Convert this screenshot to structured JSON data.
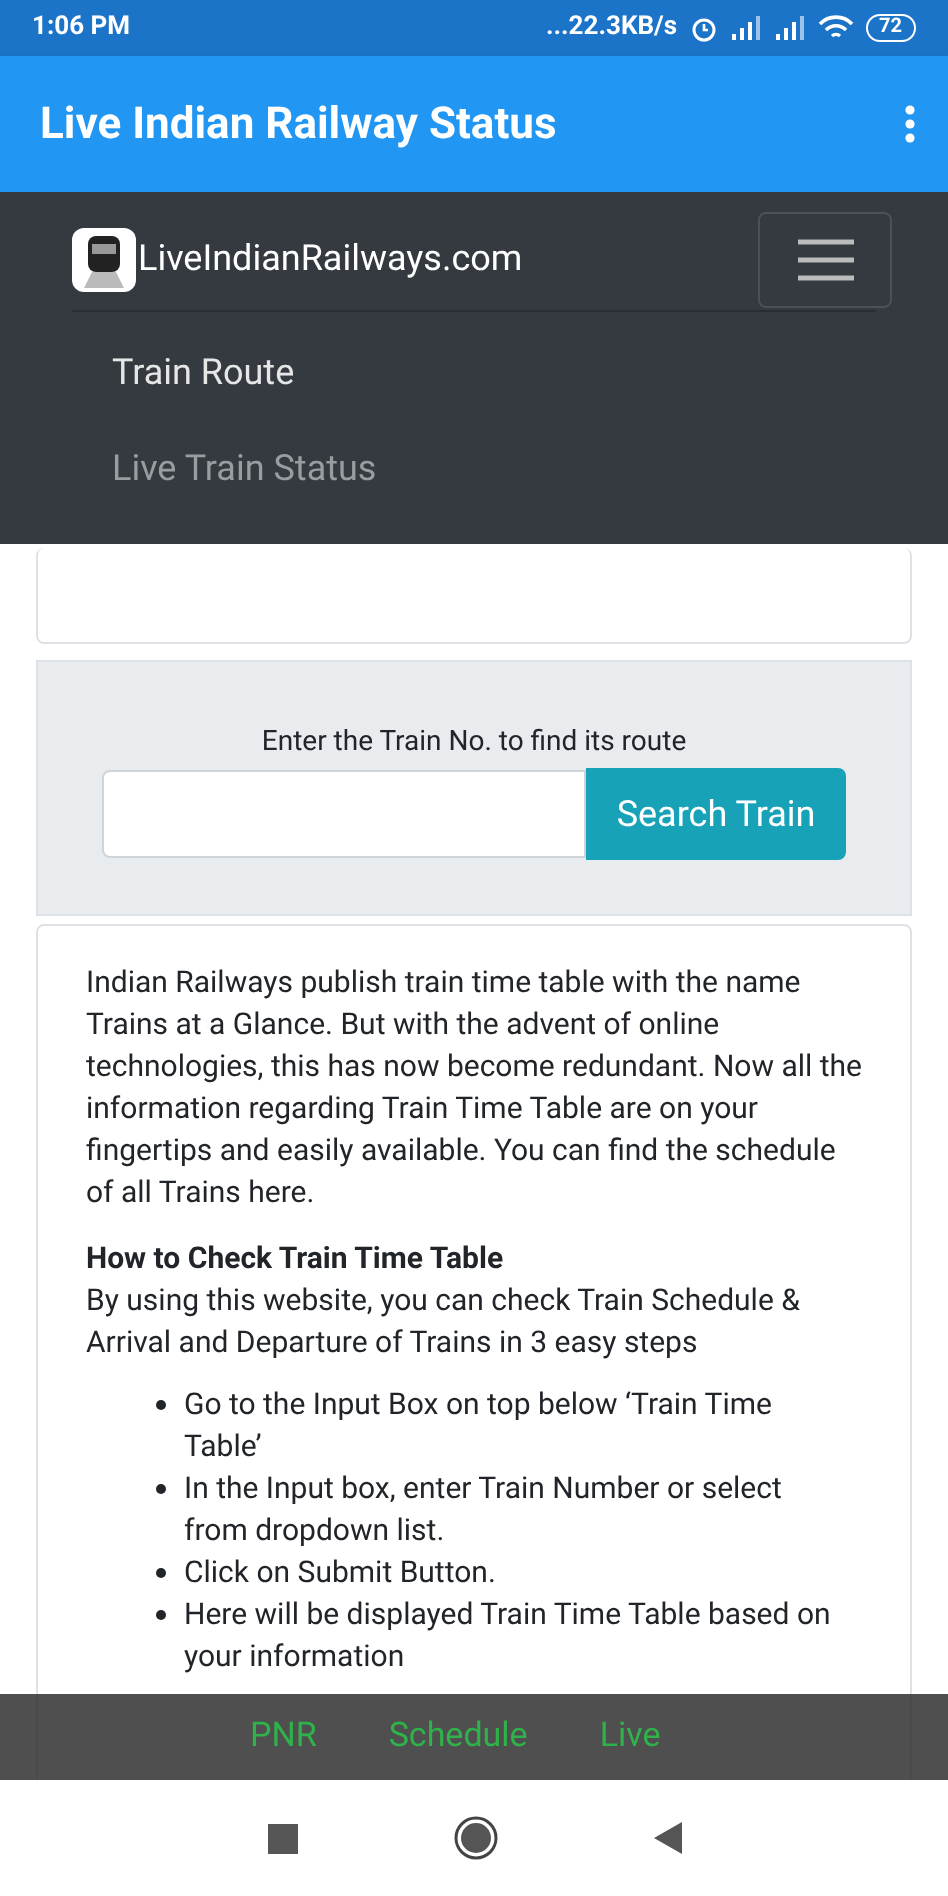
{
  "status_bar": {
    "time": "1:06 PM",
    "speed": "...22.3KB/s",
    "battery": "72"
  },
  "app_bar": {
    "title": "Live Indian Railway Status"
  },
  "site_nav": {
    "brand": "LiveIndianRailways.com",
    "items": [
      {
        "label": "Train Route",
        "selected": true
      },
      {
        "label": "Live Train Status",
        "selected": false
      }
    ]
  },
  "search": {
    "label": "Enter the Train No. to find its route",
    "button": "Search Train"
  },
  "article": {
    "intro": "Indian Railways publish train time table with the name Trains at a Glance. But with the advent of online technologies, this has now become redundant. Now all the information regarding Train Time Table are on your fingertips and easily available. You can find the schedule of all Trains here.",
    "heading": "How to Check Train Time Table",
    "text": "By using this website, you can check Train Schedule & Arrival and Departure of Trains in 3 easy steps",
    "steps": [
      "Go to the Input Box on top below ‘Train Time Table’",
      "In the Input box, enter Train Number or select from dropdown list.",
      "Click on Submit Button.",
      "Here will be displayed Train Time Table based on your information"
    ]
  },
  "bottom_tabs": [
    "PNR",
    "Schedule",
    "Live"
  ]
}
